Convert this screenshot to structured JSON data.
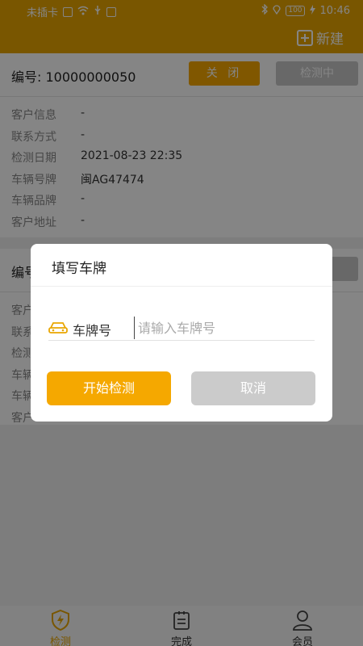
{
  "status_bar": {
    "carrier": "未插卡",
    "battery": "100",
    "time": "10:46"
  },
  "app_bar": {
    "new_label": "新建"
  },
  "cards": [
    {
      "order_label": "编号: 10000000050",
      "close_label": "关 闭",
      "status_label": "检测中",
      "rows": [
        {
          "label": "客户信息",
          "value": "-"
        },
        {
          "label": "联系方式",
          "value": "-"
        },
        {
          "label": "检测日期",
          "value": "2021-08-23 22:35"
        },
        {
          "label": "车辆号牌",
          "value": "闽AG47474"
        },
        {
          "label": "车辆品牌",
          "value": "-"
        },
        {
          "label": "客户地址",
          "value": "-"
        }
      ]
    },
    {
      "order_label": "编号",
      "rows": [
        {
          "label": "客户"
        },
        {
          "label": "联系"
        },
        {
          "label": "检测"
        },
        {
          "label": "车辆"
        },
        {
          "label": "车辆"
        },
        {
          "label": "客户"
        }
      ]
    }
  ],
  "dialog": {
    "title": "填写车牌",
    "plate_label": "车牌号",
    "plate_placeholder": "请输入车牌号",
    "plate_value": "",
    "start_label": "开始检测",
    "cancel_label": "取消"
  },
  "tabs": [
    {
      "label": "检测",
      "icon": "shield-bolt-icon",
      "active": true
    },
    {
      "label": "完成",
      "icon": "clipboard-icon",
      "active": false
    },
    {
      "label": "会员",
      "icon": "person-icon",
      "active": false
    }
  ],
  "colors": {
    "accent": "#e9a600",
    "button_primary": "#f5a800",
    "button_disabled": "#c8c8c8"
  }
}
